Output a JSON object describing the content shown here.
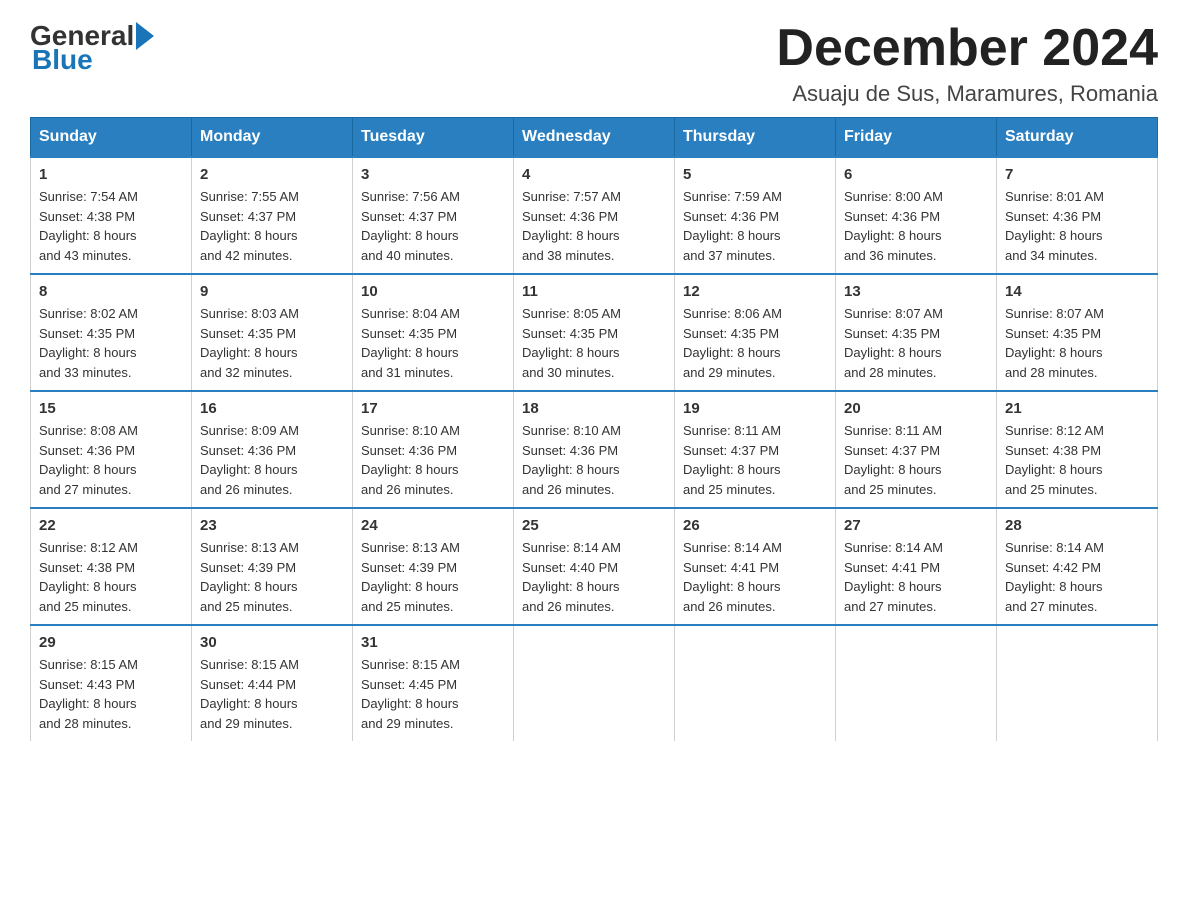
{
  "header": {
    "logo_general": "General",
    "logo_blue": "Blue",
    "month_title": "December 2024",
    "location": "Asuaju de Sus, Maramures, Romania"
  },
  "weekdays": [
    "Sunday",
    "Monday",
    "Tuesday",
    "Wednesday",
    "Thursday",
    "Friday",
    "Saturday"
  ],
  "weeks": [
    [
      {
        "day": "1",
        "sunrise": "7:54 AM",
        "sunset": "4:38 PM",
        "daylight": "8 hours and 43 minutes."
      },
      {
        "day": "2",
        "sunrise": "7:55 AM",
        "sunset": "4:37 PM",
        "daylight": "8 hours and 42 minutes."
      },
      {
        "day": "3",
        "sunrise": "7:56 AM",
        "sunset": "4:37 PM",
        "daylight": "8 hours and 40 minutes."
      },
      {
        "day": "4",
        "sunrise": "7:57 AM",
        "sunset": "4:36 PM",
        "daylight": "8 hours and 38 minutes."
      },
      {
        "day": "5",
        "sunrise": "7:59 AM",
        "sunset": "4:36 PM",
        "daylight": "8 hours and 37 minutes."
      },
      {
        "day": "6",
        "sunrise": "8:00 AM",
        "sunset": "4:36 PM",
        "daylight": "8 hours and 36 minutes."
      },
      {
        "day": "7",
        "sunrise": "8:01 AM",
        "sunset": "4:36 PM",
        "daylight": "8 hours and 34 minutes."
      }
    ],
    [
      {
        "day": "8",
        "sunrise": "8:02 AM",
        "sunset": "4:35 PM",
        "daylight": "8 hours and 33 minutes."
      },
      {
        "day": "9",
        "sunrise": "8:03 AM",
        "sunset": "4:35 PM",
        "daylight": "8 hours and 32 minutes."
      },
      {
        "day": "10",
        "sunrise": "8:04 AM",
        "sunset": "4:35 PM",
        "daylight": "8 hours and 31 minutes."
      },
      {
        "day": "11",
        "sunrise": "8:05 AM",
        "sunset": "4:35 PM",
        "daylight": "8 hours and 30 minutes."
      },
      {
        "day": "12",
        "sunrise": "8:06 AM",
        "sunset": "4:35 PM",
        "daylight": "8 hours and 29 minutes."
      },
      {
        "day": "13",
        "sunrise": "8:07 AM",
        "sunset": "4:35 PM",
        "daylight": "8 hours and 28 minutes."
      },
      {
        "day": "14",
        "sunrise": "8:07 AM",
        "sunset": "4:35 PM",
        "daylight": "8 hours and 28 minutes."
      }
    ],
    [
      {
        "day": "15",
        "sunrise": "8:08 AM",
        "sunset": "4:36 PM",
        "daylight": "8 hours and 27 minutes."
      },
      {
        "day": "16",
        "sunrise": "8:09 AM",
        "sunset": "4:36 PM",
        "daylight": "8 hours and 26 minutes."
      },
      {
        "day": "17",
        "sunrise": "8:10 AM",
        "sunset": "4:36 PM",
        "daylight": "8 hours and 26 minutes."
      },
      {
        "day": "18",
        "sunrise": "8:10 AM",
        "sunset": "4:36 PM",
        "daylight": "8 hours and 26 minutes."
      },
      {
        "day": "19",
        "sunrise": "8:11 AM",
        "sunset": "4:37 PM",
        "daylight": "8 hours and 25 minutes."
      },
      {
        "day": "20",
        "sunrise": "8:11 AM",
        "sunset": "4:37 PM",
        "daylight": "8 hours and 25 minutes."
      },
      {
        "day": "21",
        "sunrise": "8:12 AM",
        "sunset": "4:38 PM",
        "daylight": "8 hours and 25 minutes."
      }
    ],
    [
      {
        "day": "22",
        "sunrise": "8:12 AM",
        "sunset": "4:38 PM",
        "daylight": "8 hours and 25 minutes."
      },
      {
        "day": "23",
        "sunrise": "8:13 AM",
        "sunset": "4:39 PM",
        "daylight": "8 hours and 25 minutes."
      },
      {
        "day": "24",
        "sunrise": "8:13 AM",
        "sunset": "4:39 PM",
        "daylight": "8 hours and 25 minutes."
      },
      {
        "day": "25",
        "sunrise": "8:14 AM",
        "sunset": "4:40 PM",
        "daylight": "8 hours and 26 minutes."
      },
      {
        "day": "26",
        "sunrise": "8:14 AM",
        "sunset": "4:41 PM",
        "daylight": "8 hours and 26 minutes."
      },
      {
        "day": "27",
        "sunrise": "8:14 AM",
        "sunset": "4:41 PM",
        "daylight": "8 hours and 27 minutes."
      },
      {
        "day": "28",
        "sunrise": "8:14 AM",
        "sunset": "4:42 PM",
        "daylight": "8 hours and 27 minutes."
      }
    ],
    [
      {
        "day": "29",
        "sunrise": "8:15 AM",
        "sunset": "4:43 PM",
        "daylight": "8 hours and 28 minutes."
      },
      {
        "day": "30",
        "sunrise": "8:15 AM",
        "sunset": "4:44 PM",
        "daylight": "8 hours and 29 minutes."
      },
      {
        "day": "31",
        "sunrise": "8:15 AM",
        "sunset": "4:45 PM",
        "daylight": "8 hours and 29 minutes."
      },
      null,
      null,
      null,
      null
    ]
  ],
  "labels": {
    "sunrise": "Sunrise:",
    "sunset": "Sunset:",
    "daylight": "Daylight:"
  }
}
